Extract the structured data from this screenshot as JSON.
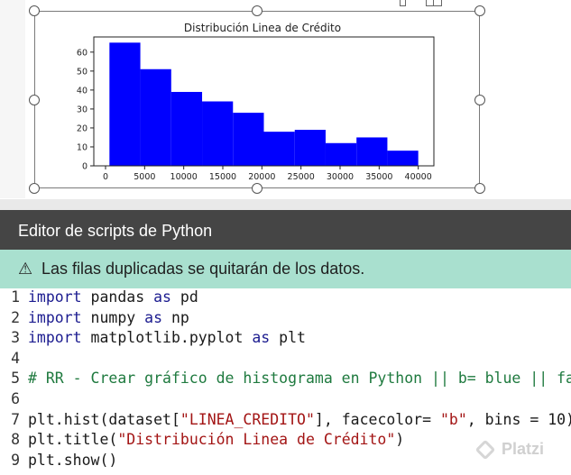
{
  "editor": {
    "title": "Editor de scripts de Python",
    "warning_icon": "warning-icon",
    "warning": "Las filas duplicadas se quitarán de los datos."
  },
  "code": {
    "lines": [
      {
        "n": "1",
        "text": "import pandas as pd"
      },
      {
        "n": "2",
        "text": "import numpy as np"
      },
      {
        "n": "3",
        "text": "import matplotlib.pyplot as plt"
      },
      {
        "n": "4",
        "text": ""
      },
      {
        "n": "5",
        "text": "# RR - Crear gráfico de histograma en Python || b= blue || face"
      },
      {
        "n": "6",
        "text": ""
      },
      {
        "n": "7",
        "text": "plt.hist(dataset[\"LINEA_CREDITO\"], facecolor= \"b\", bins = 10)"
      },
      {
        "n": "8",
        "text": "plt.title(\"Distribución Linea de Crédito\")"
      },
      {
        "n": "9",
        "text": "plt.show()"
      }
    ]
  },
  "watermark": "Platzi",
  "chart_data": {
    "type": "bar",
    "title": "Distribución Linea de Crédito",
    "xlabel": "",
    "ylabel": "",
    "bins": [
      {
        "x0": 500,
        "x1": 4450,
        "count": 65
      },
      {
        "x0": 4450,
        "x1": 8400,
        "count": 51
      },
      {
        "x0": 8400,
        "x1": 12350,
        "count": 39
      },
      {
        "x0": 12350,
        "x1": 16300,
        "count": 34
      },
      {
        "x0": 16300,
        "x1": 20250,
        "count": 28
      },
      {
        "x0": 20250,
        "x1": 24200,
        "count": 18
      },
      {
        "x0": 24200,
        "x1": 28150,
        "count": 19
      },
      {
        "x0": 28150,
        "x1": 32100,
        "count": 12
      },
      {
        "x0": 32100,
        "x1": 36050,
        "count": 15
      },
      {
        "x0": 36050,
        "x1": 40000,
        "count": 8
      }
    ],
    "xticks": [
      "0",
      "5000",
      "10000",
      "15000",
      "20000",
      "25000",
      "30000",
      "35000",
      "40000"
    ],
    "yticks": [
      "0",
      "10",
      "20",
      "30",
      "40",
      "50",
      "60"
    ],
    "xlim": [
      -1500,
      42000
    ],
    "ylim": [
      0,
      68
    ],
    "bar_color": "#0000ff"
  }
}
